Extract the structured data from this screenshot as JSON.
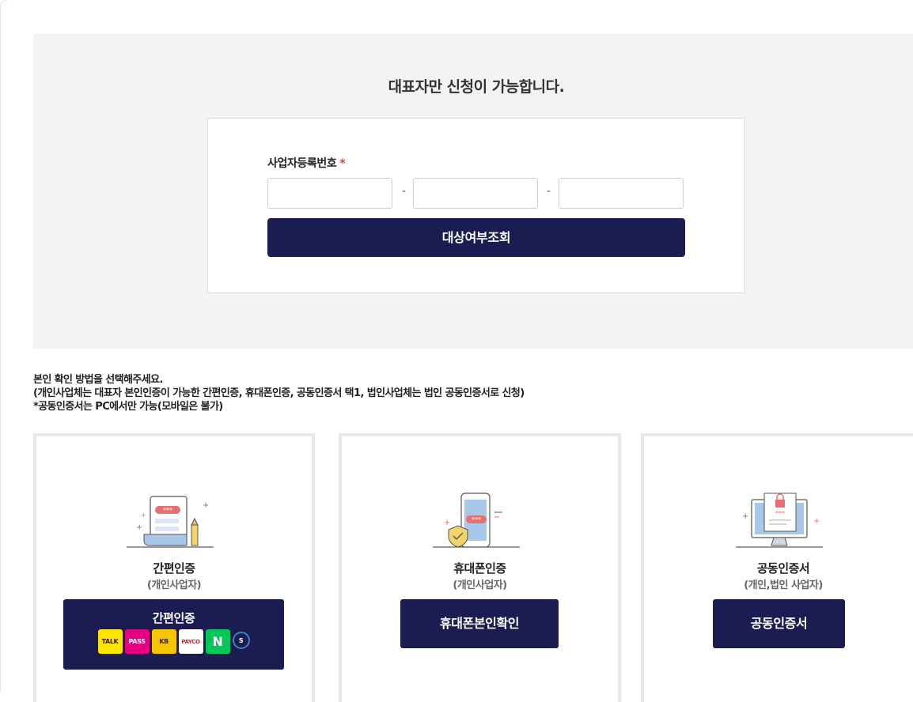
{
  "header": {
    "title": "대표자만 신청이 가능합니다."
  },
  "biz_form": {
    "label": "사업자등록번호",
    "required_mark": "*",
    "separator": "-",
    "inputs": [
      {
        "value": "",
        "placeholder": ""
      },
      {
        "value": "",
        "placeholder": ""
      },
      {
        "value": "",
        "placeholder": ""
      }
    ],
    "submit_label": "대상여부조회"
  },
  "guide": {
    "line1": "본인 확인 방법을 선택해주세요.",
    "line2": "(개인사업체는 대표자 본인인증이 가능한 간편인증, 휴대폰인증, 공동인증서 택1, 법인사업체는 법인 공동인증서로 신청)",
    "line3": "*공동인증서는 PC에서만 가능(모바일은 불가)"
  },
  "methods": [
    {
      "title": "간편인증",
      "subtitle": "(개인사업자)",
      "button_label": "간편인증",
      "icon": "document-password-icon",
      "providers": [
        {
          "name": "kakao-talk-icon",
          "label": "TALK",
          "bg": "#fee500",
          "fg": "#3a1d1d"
        },
        {
          "name": "pass-icon",
          "label": "PASS",
          "bg": "#e4007f",
          "fg": "#ffffff"
        },
        {
          "name": "kb-bank-icon",
          "label": "KB",
          "bg": "#f7c400",
          "fg": "#333333"
        },
        {
          "name": "payco-icon",
          "label": "PAYCO",
          "bg": "#ffffff",
          "fg": "#e2231a"
        },
        {
          "name": "naver-icon",
          "label": "N",
          "bg": "#03c75a",
          "fg": "#ffffff"
        },
        {
          "name": "shinhan-bank-icon",
          "label": "S",
          "bg": "#1b1d52",
          "fg": "#ffffff"
        }
      ]
    },
    {
      "title": "휴대폰인증",
      "subtitle": "(개인사업자)",
      "button_label": "휴대폰본인확인",
      "icon": "phone-shield-icon"
    },
    {
      "title": "공동인증서",
      "subtitle": "(개인,법인 사업자)",
      "button_label": "공동인증서",
      "icon": "monitor-certificate-icon"
    }
  ],
  "colors": {
    "accent": "#1b1d52",
    "required": "#e23c3c",
    "panel_bg": "#f2f3f5"
  }
}
